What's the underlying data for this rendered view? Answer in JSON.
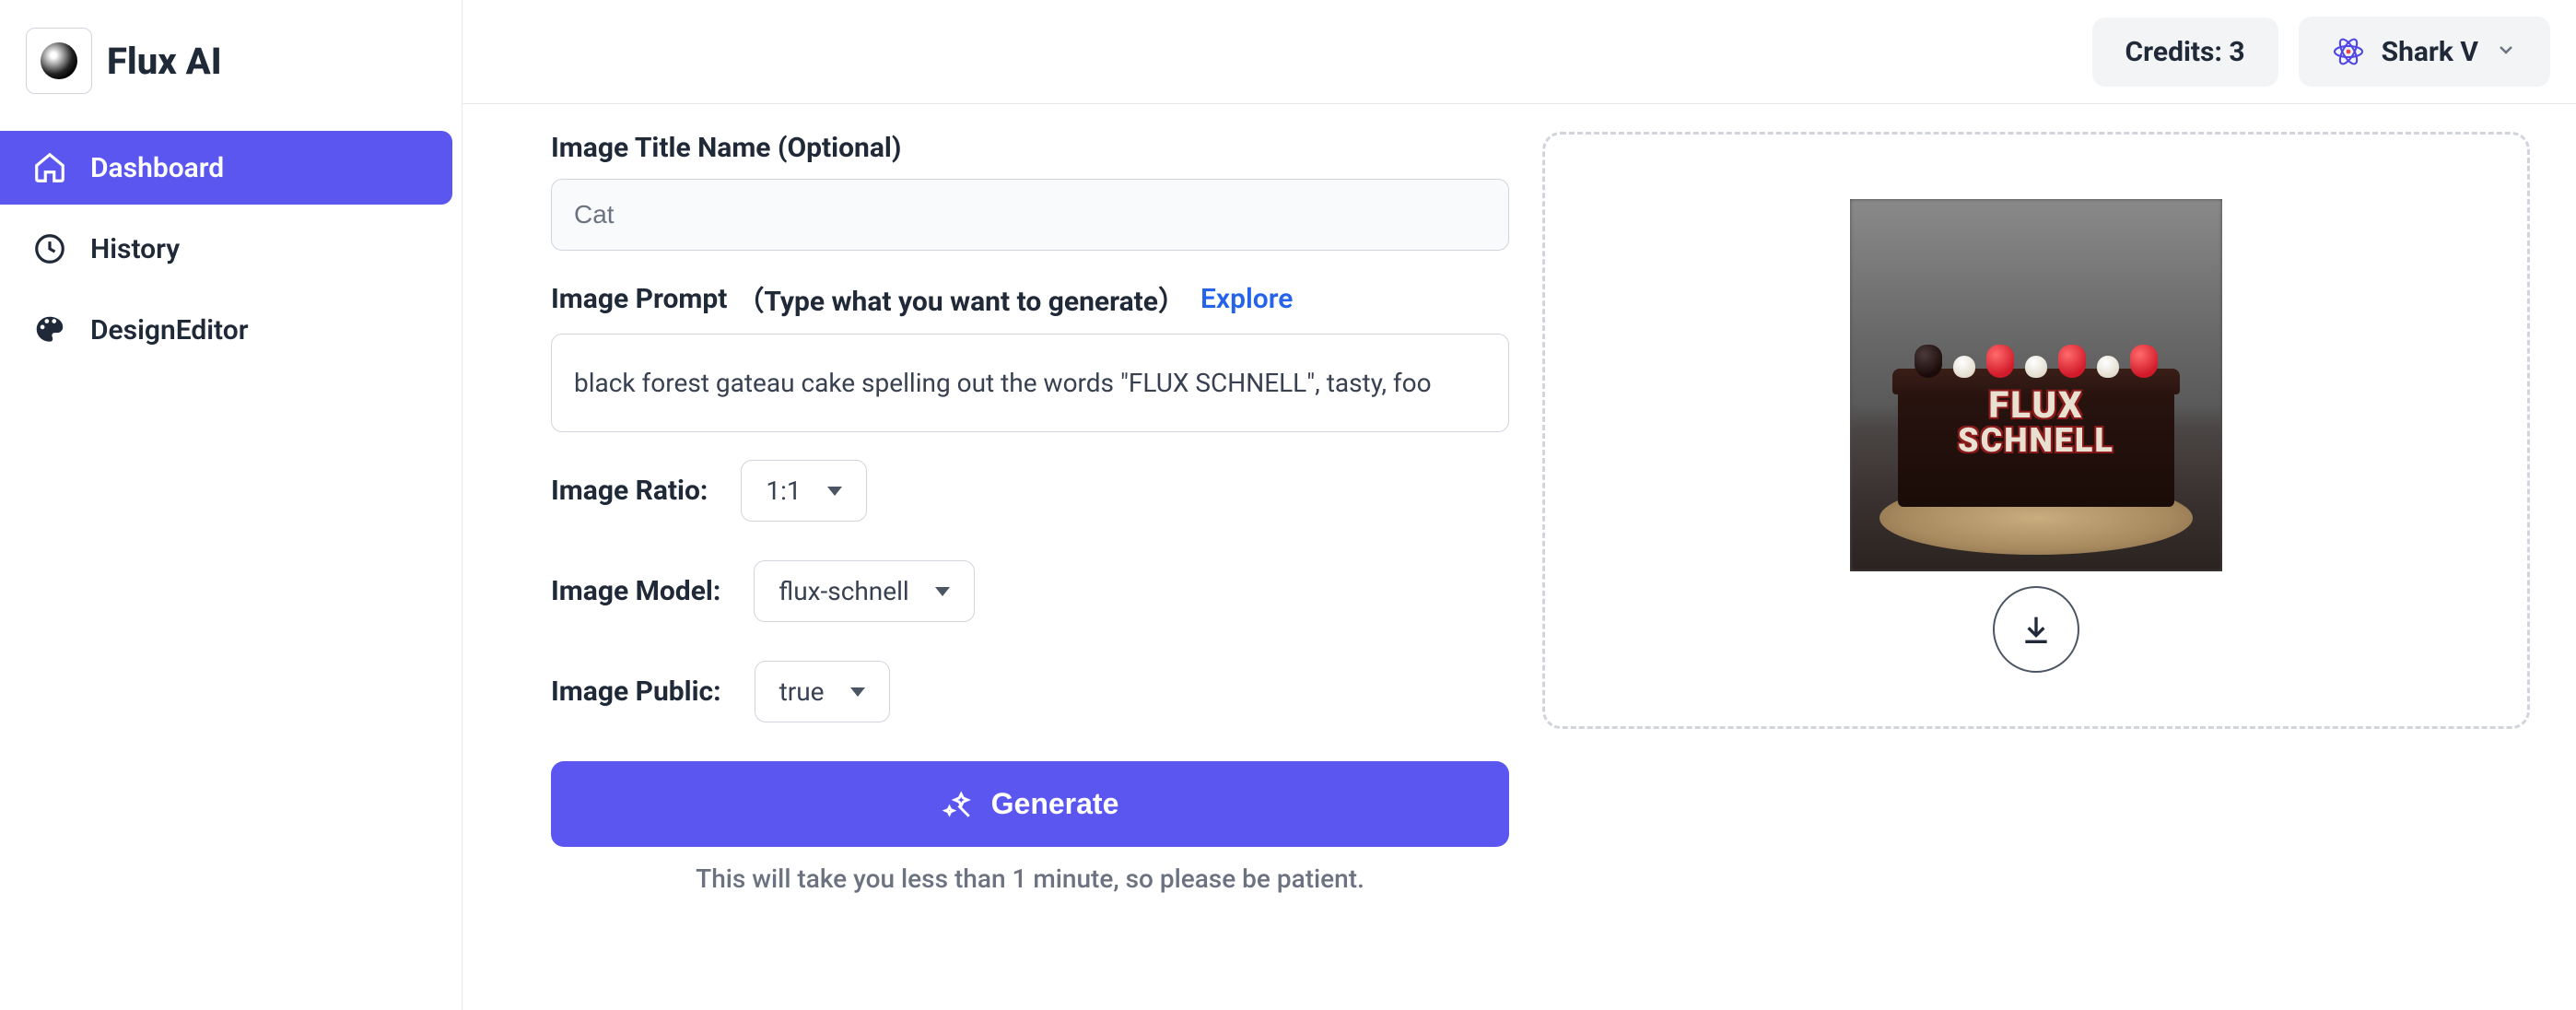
{
  "brand": {
    "name": "Flux AI"
  },
  "sidebar": {
    "items": [
      {
        "label": "Dashboard",
        "active": true
      },
      {
        "label": "History",
        "active": false
      },
      {
        "label": "DesignEditor",
        "active": false
      }
    ]
  },
  "topbar": {
    "credits_label": "Credits: 3",
    "user_name": "Shark V"
  },
  "form": {
    "title_label": "Image Title Name (Optional)",
    "title_placeholder": "Cat",
    "prompt_label": "Image Prompt",
    "prompt_sublabel": "（Type what you want to generate）",
    "explore_label": "Explore",
    "prompt_value": "black forest gateau cake spelling out the words \"FLUX SCHNELL\", tasty, foo",
    "ratio_label": "Image Ratio:",
    "ratio_value": "1:1",
    "model_label": "Image Model:",
    "model_value": "flux-schnell",
    "public_label": "Image Public:",
    "public_value": "true",
    "generate_label": "Generate",
    "hint": "This will take you less than 1 minute, so please be patient."
  },
  "preview": {
    "cake_line1": "FLUX",
    "cake_line2": "SCHNELL"
  }
}
